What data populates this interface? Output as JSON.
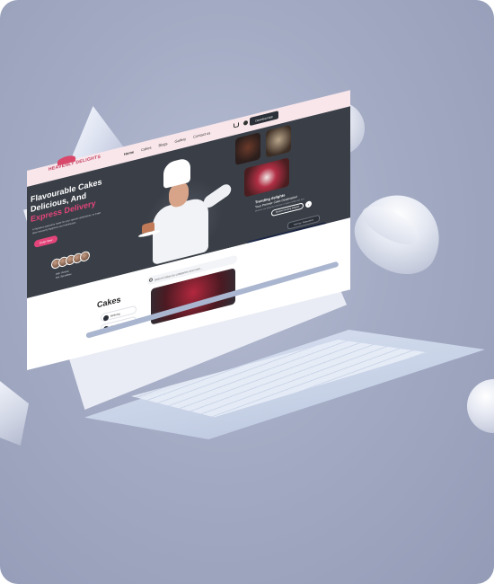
{
  "site": {
    "brand": "HEAVENLY DELIGHTS",
    "nav": [
      "Home",
      "Cakes",
      "Blogs",
      "Gallery",
      "Contact us"
    ],
    "download_button": "Download App",
    "hero_title_line1": "Flavourable Cakes",
    "hero_title_line2": "Delicious, And",
    "hero_title_accent": "Express Delivery",
    "hero_desc": "A Signature patisserie made for your special celebrations, to make them heavenly happiness and satisfaction.",
    "order_button": "Order Now",
    "reviews_label": "200+ Review",
    "reviews_sub": "Fav. Specialties",
    "trending_title": "Trending delights",
    "trending_subtitle": "Your Premier Cake Destination!",
    "trending_desc": "Discover our delightful selection of cakes made with love",
    "explore_button": "Explore trending delights",
    "explore_arrow": "›",
    "sort_label": "Sort by: Relevance",
    "search_placeholder": "Search Cakes by categories and more...",
    "cakes_heading": "Cakes",
    "filters": [
      "Birthday",
      "Wedding"
    ]
  }
}
